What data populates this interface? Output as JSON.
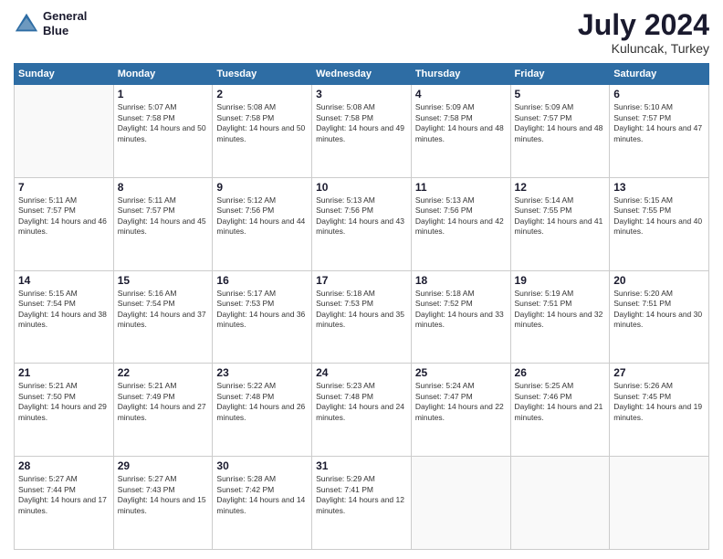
{
  "logo": {
    "line1": "General",
    "line2": "Blue"
  },
  "title": "July 2024",
  "subtitle": "Kuluncak, Turkey",
  "days_header": [
    "Sunday",
    "Monday",
    "Tuesday",
    "Wednesday",
    "Thursday",
    "Friday",
    "Saturday"
  ],
  "weeks": [
    [
      {
        "day": "",
        "sunrise": "",
        "sunset": "",
        "daylight": ""
      },
      {
        "day": "1",
        "sunrise": "Sunrise: 5:07 AM",
        "sunset": "Sunset: 7:58 PM",
        "daylight": "Daylight: 14 hours and 50 minutes."
      },
      {
        "day": "2",
        "sunrise": "Sunrise: 5:08 AM",
        "sunset": "Sunset: 7:58 PM",
        "daylight": "Daylight: 14 hours and 50 minutes."
      },
      {
        "day": "3",
        "sunrise": "Sunrise: 5:08 AM",
        "sunset": "Sunset: 7:58 PM",
        "daylight": "Daylight: 14 hours and 49 minutes."
      },
      {
        "day": "4",
        "sunrise": "Sunrise: 5:09 AM",
        "sunset": "Sunset: 7:58 PM",
        "daylight": "Daylight: 14 hours and 48 minutes."
      },
      {
        "day": "5",
        "sunrise": "Sunrise: 5:09 AM",
        "sunset": "Sunset: 7:57 PM",
        "daylight": "Daylight: 14 hours and 48 minutes."
      },
      {
        "day": "6",
        "sunrise": "Sunrise: 5:10 AM",
        "sunset": "Sunset: 7:57 PM",
        "daylight": "Daylight: 14 hours and 47 minutes."
      }
    ],
    [
      {
        "day": "7",
        "sunrise": "Sunrise: 5:11 AM",
        "sunset": "Sunset: 7:57 PM",
        "daylight": "Daylight: 14 hours and 46 minutes."
      },
      {
        "day": "8",
        "sunrise": "Sunrise: 5:11 AM",
        "sunset": "Sunset: 7:57 PM",
        "daylight": "Daylight: 14 hours and 45 minutes."
      },
      {
        "day": "9",
        "sunrise": "Sunrise: 5:12 AM",
        "sunset": "Sunset: 7:56 PM",
        "daylight": "Daylight: 14 hours and 44 minutes."
      },
      {
        "day": "10",
        "sunrise": "Sunrise: 5:13 AM",
        "sunset": "Sunset: 7:56 PM",
        "daylight": "Daylight: 14 hours and 43 minutes."
      },
      {
        "day": "11",
        "sunrise": "Sunrise: 5:13 AM",
        "sunset": "Sunset: 7:56 PM",
        "daylight": "Daylight: 14 hours and 42 minutes."
      },
      {
        "day": "12",
        "sunrise": "Sunrise: 5:14 AM",
        "sunset": "Sunset: 7:55 PM",
        "daylight": "Daylight: 14 hours and 41 minutes."
      },
      {
        "day": "13",
        "sunrise": "Sunrise: 5:15 AM",
        "sunset": "Sunset: 7:55 PM",
        "daylight": "Daylight: 14 hours and 40 minutes."
      }
    ],
    [
      {
        "day": "14",
        "sunrise": "Sunrise: 5:15 AM",
        "sunset": "Sunset: 7:54 PM",
        "daylight": "Daylight: 14 hours and 38 minutes."
      },
      {
        "day": "15",
        "sunrise": "Sunrise: 5:16 AM",
        "sunset": "Sunset: 7:54 PM",
        "daylight": "Daylight: 14 hours and 37 minutes."
      },
      {
        "day": "16",
        "sunrise": "Sunrise: 5:17 AM",
        "sunset": "Sunset: 7:53 PM",
        "daylight": "Daylight: 14 hours and 36 minutes."
      },
      {
        "day": "17",
        "sunrise": "Sunrise: 5:18 AM",
        "sunset": "Sunset: 7:53 PM",
        "daylight": "Daylight: 14 hours and 35 minutes."
      },
      {
        "day": "18",
        "sunrise": "Sunrise: 5:18 AM",
        "sunset": "Sunset: 7:52 PM",
        "daylight": "Daylight: 14 hours and 33 minutes."
      },
      {
        "day": "19",
        "sunrise": "Sunrise: 5:19 AM",
        "sunset": "Sunset: 7:51 PM",
        "daylight": "Daylight: 14 hours and 32 minutes."
      },
      {
        "day": "20",
        "sunrise": "Sunrise: 5:20 AM",
        "sunset": "Sunset: 7:51 PM",
        "daylight": "Daylight: 14 hours and 30 minutes."
      }
    ],
    [
      {
        "day": "21",
        "sunrise": "Sunrise: 5:21 AM",
        "sunset": "Sunset: 7:50 PM",
        "daylight": "Daylight: 14 hours and 29 minutes."
      },
      {
        "day": "22",
        "sunrise": "Sunrise: 5:21 AM",
        "sunset": "Sunset: 7:49 PM",
        "daylight": "Daylight: 14 hours and 27 minutes."
      },
      {
        "day": "23",
        "sunrise": "Sunrise: 5:22 AM",
        "sunset": "Sunset: 7:48 PM",
        "daylight": "Daylight: 14 hours and 26 minutes."
      },
      {
        "day": "24",
        "sunrise": "Sunrise: 5:23 AM",
        "sunset": "Sunset: 7:48 PM",
        "daylight": "Daylight: 14 hours and 24 minutes."
      },
      {
        "day": "25",
        "sunrise": "Sunrise: 5:24 AM",
        "sunset": "Sunset: 7:47 PM",
        "daylight": "Daylight: 14 hours and 22 minutes."
      },
      {
        "day": "26",
        "sunrise": "Sunrise: 5:25 AM",
        "sunset": "Sunset: 7:46 PM",
        "daylight": "Daylight: 14 hours and 21 minutes."
      },
      {
        "day": "27",
        "sunrise": "Sunrise: 5:26 AM",
        "sunset": "Sunset: 7:45 PM",
        "daylight": "Daylight: 14 hours and 19 minutes."
      }
    ],
    [
      {
        "day": "28",
        "sunrise": "Sunrise: 5:27 AM",
        "sunset": "Sunset: 7:44 PM",
        "daylight": "Daylight: 14 hours and 17 minutes."
      },
      {
        "day": "29",
        "sunrise": "Sunrise: 5:27 AM",
        "sunset": "Sunset: 7:43 PM",
        "daylight": "Daylight: 14 hours and 15 minutes."
      },
      {
        "day": "30",
        "sunrise": "Sunrise: 5:28 AM",
        "sunset": "Sunset: 7:42 PM",
        "daylight": "Daylight: 14 hours and 14 minutes."
      },
      {
        "day": "31",
        "sunrise": "Sunrise: 5:29 AM",
        "sunset": "Sunset: 7:41 PM",
        "daylight": "Daylight: 14 hours and 12 minutes."
      },
      {
        "day": "",
        "sunrise": "",
        "sunset": "",
        "daylight": ""
      },
      {
        "day": "",
        "sunrise": "",
        "sunset": "",
        "daylight": ""
      },
      {
        "day": "",
        "sunrise": "",
        "sunset": "",
        "daylight": ""
      }
    ]
  ]
}
